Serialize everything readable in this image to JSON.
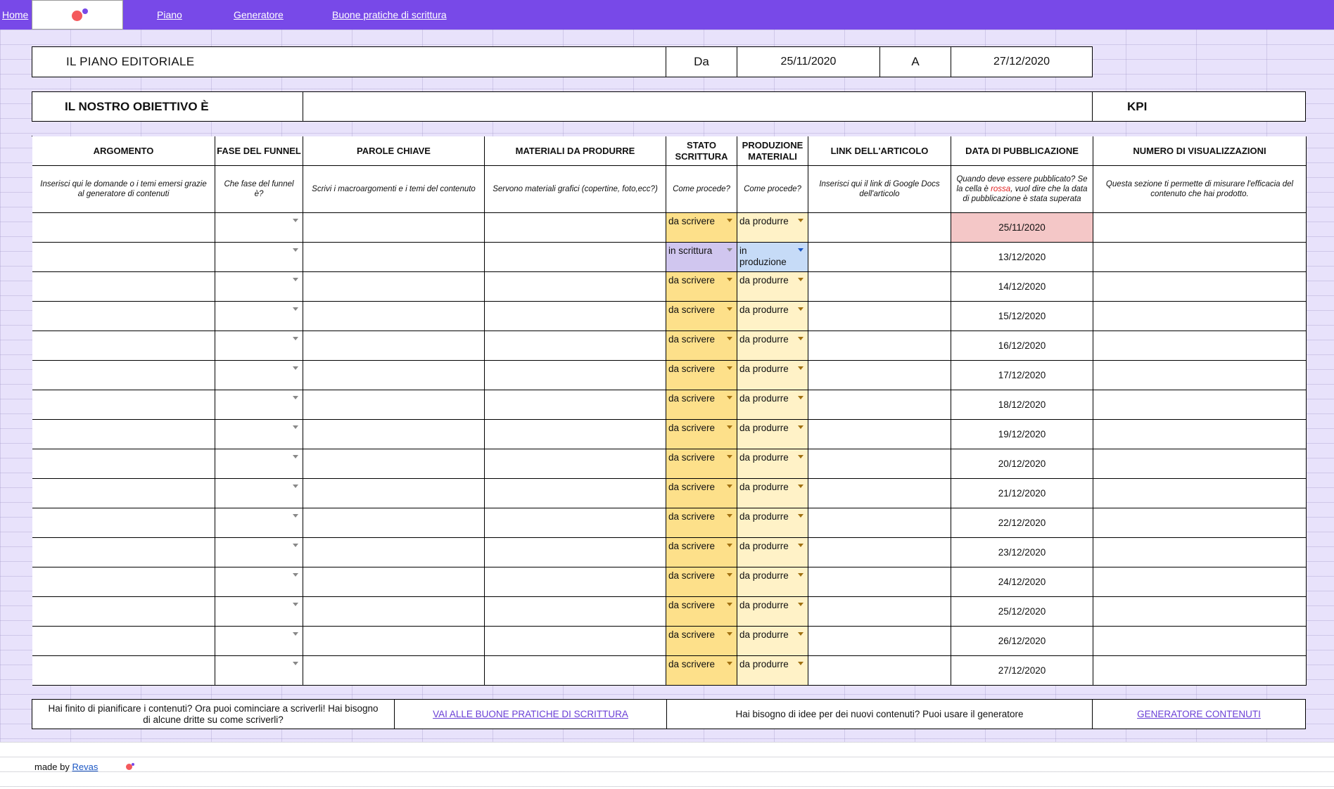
{
  "nav": {
    "home": "Home",
    "piano": "Piano",
    "generatore": "Generatore",
    "buone_pratiche": "Buone pratiche di scrittura"
  },
  "header": {
    "title": "IL PIANO EDITORIALE",
    "da_label": "Da",
    "da_value": "25/11/2020",
    "a_label": "A",
    "a_value": "27/12/2020"
  },
  "objective": {
    "label": "IL NOSTRO OBIETTIVO È",
    "value": "",
    "kpi_label": "KPI"
  },
  "columns": [
    {
      "title": "ARGOMENTO",
      "desc": "Inserisci qui le domande o i temi emersi grazie al generatore di contenuti"
    },
    {
      "title": "FASE DEL FUNNEL",
      "desc": "Che fase del funnel è?"
    },
    {
      "title": "PAROLE CHIAVE",
      "desc": "Scrivi i macroargomenti e i temi del contenuto"
    },
    {
      "title": "MATERIALI DA PRODURRE",
      "desc": "Servono materiali grafici (copertine, foto,ecc?)"
    },
    {
      "title": "STATO SCRITTURA",
      "desc": "Come procede?"
    },
    {
      "title": "PRODUZIONE MATERIALI",
      "desc": "Come procede?"
    },
    {
      "title": "LINK DELL'ARTICOLO",
      "desc": "Inserisci qui il link di Google Docs dell'articolo"
    },
    {
      "title": "DATA DI PUBBLICAZIONE",
      "desc_a": "Quando deve essere pubblicato? Se la cella è ",
      "desc_red": "rossa",
      "desc_b": ", vuol dire che la data di pubblicazione è stata superata"
    },
    {
      "title": "NUMERO DI VISUALIZZAZIONI",
      "desc": "Questa sezione ti permette di misurare l'efficacia del contenuto che hai prodotto."
    }
  ],
  "rows": [
    {
      "stato": "da scrivere",
      "produzione": "da produrre",
      "data": "25/11/2020",
      "stato_color": "yellow",
      "prod_color": "cream",
      "overdue": true
    },
    {
      "stato": "in scrittura",
      "produzione": "in produzione",
      "data": "13/12/2020",
      "stato_color": "purple",
      "prod_color": "blue",
      "overdue": false
    },
    {
      "stato": "da scrivere",
      "produzione": "da produrre",
      "data": "14/12/2020",
      "stato_color": "yellow",
      "prod_color": "cream",
      "overdue": false
    },
    {
      "stato": "da scrivere",
      "produzione": "da produrre",
      "data": "15/12/2020",
      "stato_color": "yellow",
      "prod_color": "cream",
      "overdue": false
    },
    {
      "stato": "da scrivere",
      "produzione": "da produrre",
      "data": "16/12/2020",
      "stato_color": "yellow",
      "prod_color": "cream",
      "overdue": false
    },
    {
      "stato": "da scrivere",
      "produzione": "da produrre",
      "data": "17/12/2020",
      "stato_color": "yellow",
      "prod_color": "cream",
      "overdue": false
    },
    {
      "stato": "da scrivere",
      "produzione": "da produrre",
      "data": "18/12/2020",
      "stato_color": "yellow",
      "prod_color": "cream",
      "overdue": false
    },
    {
      "stato": "da scrivere",
      "produzione": "da produrre",
      "data": "19/12/2020",
      "stato_color": "yellow",
      "prod_color": "cream",
      "overdue": false
    },
    {
      "stato": "da scrivere",
      "produzione": "da produrre",
      "data": "20/12/2020",
      "stato_color": "yellow",
      "prod_color": "cream",
      "overdue": false
    },
    {
      "stato": "da scrivere",
      "produzione": "da produrre",
      "data": "21/12/2020",
      "stato_color": "yellow",
      "prod_color": "cream",
      "overdue": false
    },
    {
      "stato": "da scrivere",
      "produzione": "da produrre",
      "data": "22/12/2020",
      "stato_color": "yellow",
      "prod_color": "cream",
      "overdue": false
    },
    {
      "stato": "da scrivere",
      "produzione": "da produrre",
      "data": "23/12/2020",
      "stato_color": "yellow",
      "prod_color": "cream",
      "overdue": false
    },
    {
      "stato": "da scrivere",
      "produzione": "da produrre",
      "data": "24/12/2020",
      "stato_color": "yellow",
      "prod_color": "cream",
      "overdue": false
    },
    {
      "stato": "da scrivere",
      "produzione": "da produrre",
      "data": "25/12/2020",
      "stato_color": "yellow",
      "prod_color": "cream",
      "overdue": false
    },
    {
      "stato": "da scrivere",
      "produzione": "da produrre",
      "data": "26/12/2020",
      "stato_color": "yellow",
      "prod_color": "cream",
      "overdue": false
    },
    {
      "stato": "da scrivere",
      "produzione": "da produrre",
      "data": "27/12/2020",
      "stato_color": "yellow",
      "prod_color": "cream",
      "overdue": false
    }
  ],
  "colors": {
    "nav": "#7849e8",
    "stato_yellow": "#fde08a",
    "stato_purple": "#d0c6ef",
    "prod_cream": "#fff2c7",
    "prod_blue": "#c6dbf7",
    "overdue": "#f4c7c7"
  },
  "footer": {
    "text1": "Hai finito di pianificare i contenuti? Ora puoi cominciare a scriverli! Hai bisogno di alcune dritte su come scriverli?",
    "link1": "VAI ALLE BUONE PRATICHE DI SCRITTURA",
    "text2": "Hai bisogno di idee per dei nuovi contenuti? Puoi usare il generatore",
    "link2": "GENERATORE CONTENUTI"
  },
  "credits": {
    "made_by": "made by",
    "author": "Revas"
  }
}
